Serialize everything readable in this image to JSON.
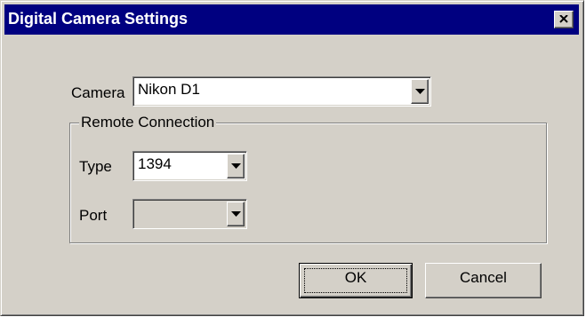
{
  "window": {
    "title": "Digital Camera Settings",
    "close_icon": "close-x-icon"
  },
  "camera": {
    "label": "Camera",
    "value": "Nikon D1"
  },
  "remote_connection": {
    "legend": "Remote Connection",
    "type_label": "Type",
    "type_value": "1394",
    "port_label": "Port",
    "port_value": ""
  },
  "buttons": {
    "ok": "OK",
    "cancel": "Cancel"
  },
  "colors": {
    "title_bar": "#000080",
    "face": "#d4d0c8"
  }
}
